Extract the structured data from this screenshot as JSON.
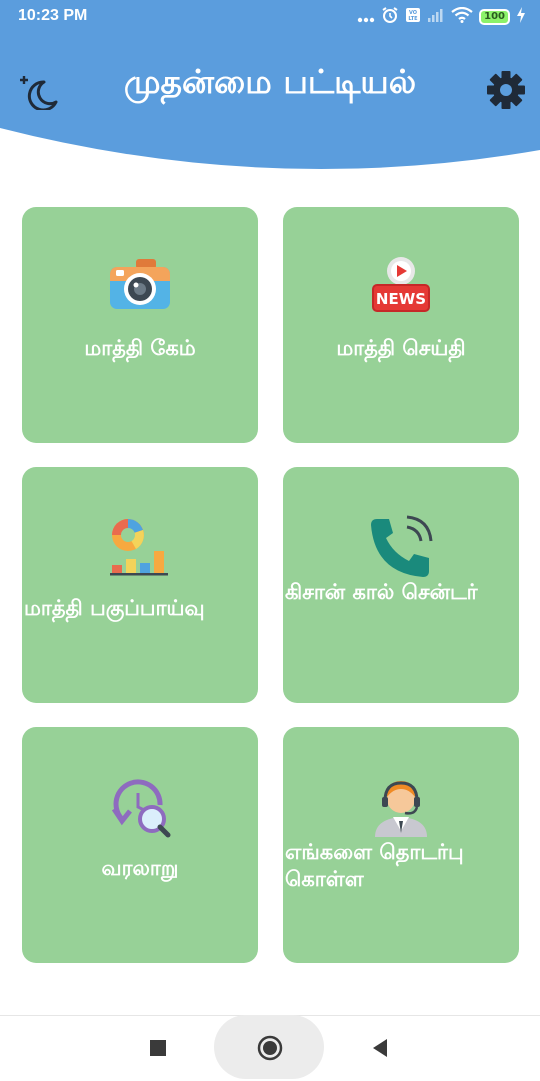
{
  "status_bar": {
    "time": "10:23 PM",
    "battery": "100"
  },
  "header": {
    "title": "முதன்மை பட்டியல்",
    "color": "#5b9ddd"
  },
  "cards": [
    {
      "label": "மாத்தி கேம்",
      "icon": "camera-icon"
    },
    {
      "label": "மாத்தி செய்தி",
      "icon": "news-icon"
    },
    {
      "label": "மாத்தி பகுப்பாய்வு",
      "icon": "analytics-icon"
    },
    {
      "label": "கிசான் கால் சென்டர்",
      "icon": "phone-icon"
    },
    {
      "label": "வரலாறு",
      "icon": "history-icon"
    },
    {
      "label": "எங்களை தொடர்பு கொள்ள",
      "icon": "support-agent-icon"
    }
  ],
  "card_color": "#97d197",
  "nav_bar": {
    "icons": [
      "recents-square-icon",
      "home-circle-icon",
      "back-triangle-icon"
    ]
  }
}
